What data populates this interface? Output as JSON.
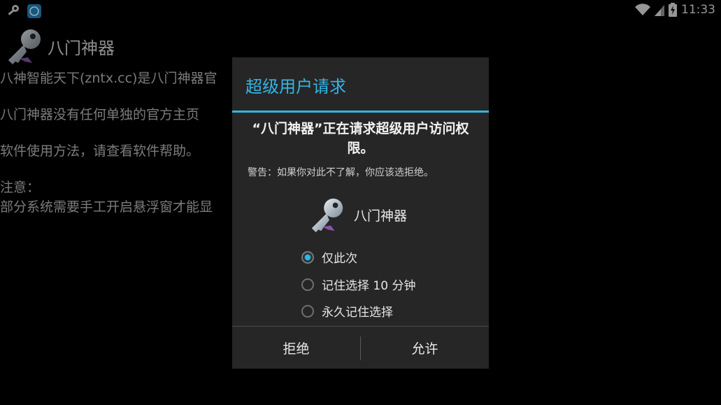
{
  "status_bar": {
    "notification_icons": [
      "key-notification-icon",
      "app-notification-icon"
    ],
    "time": "11:33",
    "system_icons": [
      "wifi-icon",
      "signal-icon",
      "battery-charging-icon"
    ]
  },
  "app": {
    "title": "八门神器",
    "lines": [
      "八神智能天下(zntx.cc)是八门神器官",
      "八门神器没有任何单独的官方主页",
      "软件使用方法，请查看软件帮助。"
    ],
    "note_label": "注意：",
    "note_text": "部分系统需要手工开启悬浮窗才能显"
  },
  "dialog": {
    "title": "超级用户请求",
    "heading": "“八门神器”正在请求超级用户访问权限。",
    "warning": "警告：如果你对此不了解，你应该选拒绝。",
    "app_name": "八门神器",
    "options": [
      {
        "label": "仅此次",
        "checked": true
      },
      {
        "label": "记住选择 10 分钟",
        "checked": false
      },
      {
        "label": "永久记住选择",
        "checked": false
      }
    ],
    "deny_label": "拒绝",
    "allow_label": "允许"
  },
  "colors": {
    "accent": "#33b5e5",
    "dialog_bg": "#262626",
    "background": "#000000"
  }
}
